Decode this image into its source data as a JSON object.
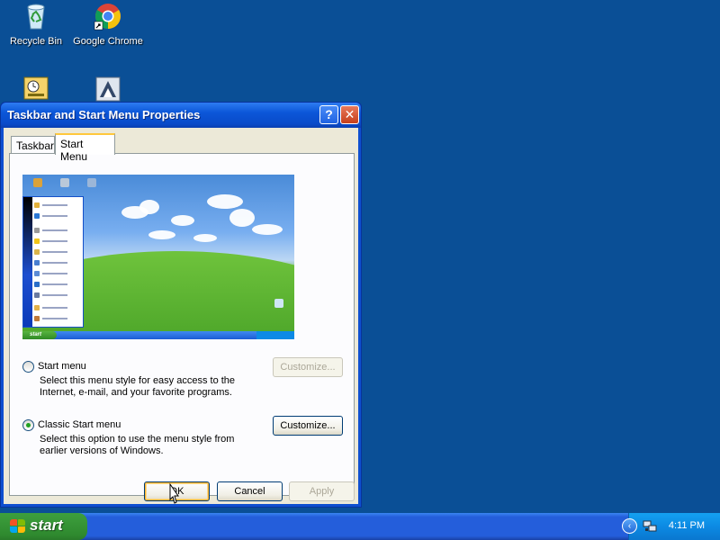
{
  "desktop": {
    "icons": [
      {
        "label": "Recycle Bin",
        "icon": "recycle-bin-icon"
      },
      {
        "label": "Google Chrome",
        "icon": "chrome-icon"
      },
      {
        "label": "",
        "icon": "scheduled-tasks-icon"
      },
      {
        "label": "",
        "icon": "application-icon"
      }
    ]
  },
  "dialog": {
    "title": "Taskbar and Start Menu Properties",
    "help_glyph": "?",
    "close_glyph": "✕",
    "tabs": [
      {
        "label": "Taskbar",
        "active": false
      },
      {
        "label": "Start Menu",
        "active": true
      }
    ],
    "preview": {
      "start_label": "start"
    },
    "options": [
      {
        "label": "Start menu",
        "checked": false,
        "description": [
          "Select this menu style for easy access to the",
          "Internet, e-mail, and your favorite programs."
        ],
        "customize_label": "Customize...",
        "customize_enabled": false
      },
      {
        "label": "Classic Start menu",
        "checked": true,
        "description": [
          "Select this option to use the menu style from",
          "earlier versions of Windows."
        ],
        "customize_label": "Customize...",
        "customize_enabled": true
      }
    ],
    "buttons": {
      "ok": "OK",
      "cancel": "Cancel",
      "apply": "Apply"
    }
  },
  "taskbar": {
    "start_label": "start",
    "clock": "4:11 PM",
    "tray_arrow": "‹"
  },
  "colors": {
    "desktop": "#0a4f96",
    "title_bar": "#0b56d8",
    "start_button": "#2f8a2f",
    "tray": "#0c8ae3"
  }
}
